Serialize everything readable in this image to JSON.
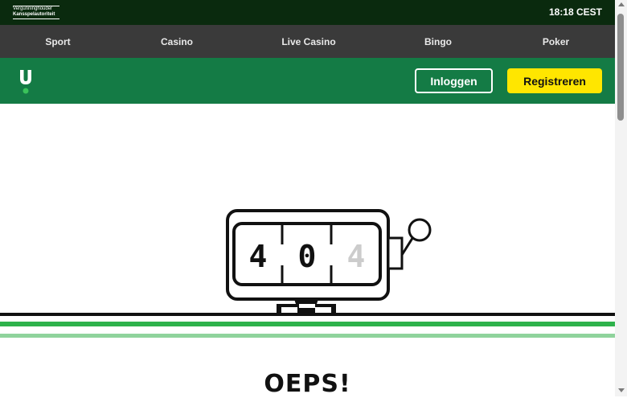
{
  "topbar": {
    "license_line1": "Vergunninghouder",
    "license_line2": "Kansspelautoriteit",
    "time": "18:18 CEST"
  },
  "nav": {
    "items": [
      {
        "label": "Sport"
      },
      {
        "label": "Casino"
      },
      {
        "label": "Live Casino"
      },
      {
        "label": "Bingo"
      },
      {
        "label": "Poker"
      }
    ]
  },
  "header": {
    "login_label": "Inloggen",
    "register_label": "Registreren"
  },
  "error": {
    "digits": [
      "4",
      "0",
      "4"
    ],
    "heading": "OEPS!"
  },
  "colors": {
    "brand_green": "#147b45",
    "register_yellow": "#ffe600",
    "topbar": "#0a2a0e",
    "nav": "#3a3a3a"
  }
}
